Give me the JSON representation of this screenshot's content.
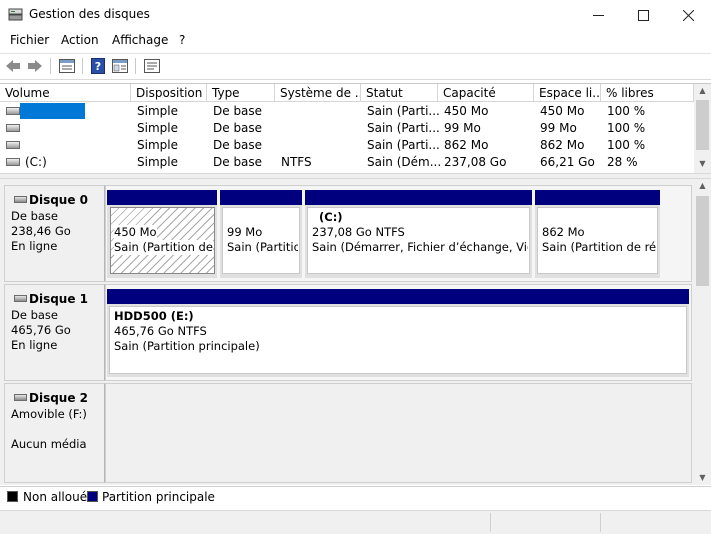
{
  "window": {
    "title": "Gestion des disques",
    "icons": {
      "app": "disk-management-icon",
      "minimize": "minimize-icon",
      "maximize": "maximize-icon",
      "close": "close-icon"
    }
  },
  "menu": {
    "items": [
      "Fichier",
      "Action",
      "Affichage",
      "?"
    ]
  },
  "toolbar": {
    "buttons": [
      "back-arrow-icon",
      "forward-arrow-icon",
      "volume-list-icon",
      "help-icon",
      "console-tree-icon",
      "properties-icon"
    ]
  },
  "volume_list": {
    "columns": [
      "Volume",
      "Disposition",
      "Type",
      "Système de ...",
      "Statut",
      "Capacité",
      "Espace li...",
      "% libres"
    ],
    "rows": [
      {
        "volume": "",
        "disposition": "Simple",
        "type": "De base",
        "fs": "",
        "statut": "Sain (Parti...",
        "capacite": "450 Mo",
        "espace": "450 Mo",
        "libres": "100 %",
        "selected": true
      },
      {
        "volume": "",
        "disposition": "Simple",
        "type": "De base",
        "fs": "",
        "statut": "Sain (Parti...",
        "capacite": "99 Mo",
        "espace": "99 Mo",
        "libres": "100 %",
        "selected": false
      },
      {
        "volume": "",
        "disposition": "Simple",
        "type": "De base",
        "fs": "",
        "statut": "Sain (Parti...",
        "capacite": "862 Mo",
        "espace": "862 Mo",
        "libres": "100 %",
        "selected": false
      },
      {
        "volume": "(C:)",
        "disposition": "Simple",
        "type": "De base",
        "fs": "NTFS",
        "statut": "Sain (Dém...",
        "capacite": "237,08 Go",
        "espace": "66,21 Go",
        "libres": "28 %",
        "selected": false
      }
    ]
  },
  "disks": [
    {
      "name": "Disque 0",
      "type": "De base",
      "size": "238,46 Go",
      "status": "En ligne",
      "partitions": [
        {
          "label": "",
          "size": "450 Mo",
          "status": "Sain (Partition de r",
          "hatched": true
        },
        {
          "label": "",
          "size": "99 Mo",
          "status": "Sain (Partitio",
          "hatched": false
        },
        {
          "label": "(C:)",
          "size": "237,08 Go NTFS",
          "status": "Sain (Démarrer, Fichier d’échange, Vidag",
          "hatched": false
        },
        {
          "label": "",
          "size": "862 Mo",
          "status": "Sain (Partition de récu",
          "hatched": false
        }
      ]
    },
    {
      "name": "Disque 1",
      "type": "De base",
      "size": "465,76 Go",
      "status": "En ligne",
      "partitions": [
        {
          "label": "HDD500  (E:)",
          "size": "465,76 Go NTFS",
          "status": "Sain (Partition principale)",
          "hatched": false
        }
      ]
    },
    {
      "name": "Disque 2",
      "type": "Amovible (F:)",
      "size": "",
      "status": "Aucun média",
      "partitions": []
    }
  ],
  "legend": [
    {
      "label": "Non alloué",
      "color": "#000000"
    },
    {
      "label": "Partition principale",
      "color": "#00007f"
    }
  ],
  "colors": {
    "selection": "#0078d7",
    "partition_bar": "#00007f"
  }
}
